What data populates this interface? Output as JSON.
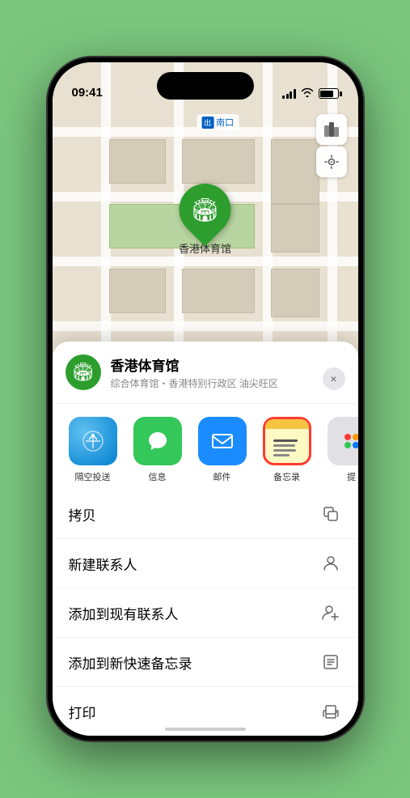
{
  "status_bar": {
    "time": "09:41",
    "location_arrow": "▶"
  },
  "map": {
    "label": "南口",
    "label_prefix": "⬛"
  },
  "location_pin": {
    "label": "香港体育馆"
  },
  "venue_card": {
    "name": "香港体育馆",
    "description": "综合体育馆・香港特别行政区 油尖旺区",
    "close_label": "×"
  },
  "share_apps": [
    {
      "id": "airdrop",
      "label": "隔空投送"
    },
    {
      "id": "messages",
      "label": "信息"
    },
    {
      "id": "mail",
      "label": "邮件"
    },
    {
      "id": "notes",
      "label": "备忘录"
    },
    {
      "id": "more",
      "label": "提"
    }
  ],
  "actions": [
    {
      "id": "copy",
      "label": "拷贝",
      "icon": "copy"
    },
    {
      "id": "new-contact",
      "label": "新建联系人",
      "icon": "person"
    },
    {
      "id": "add-contact",
      "label": "添加到现有联系人",
      "icon": "person-add"
    },
    {
      "id": "quick-note",
      "label": "添加到新快速备忘录",
      "icon": "note"
    },
    {
      "id": "print",
      "label": "打印",
      "icon": "print"
    }
  ]
}
